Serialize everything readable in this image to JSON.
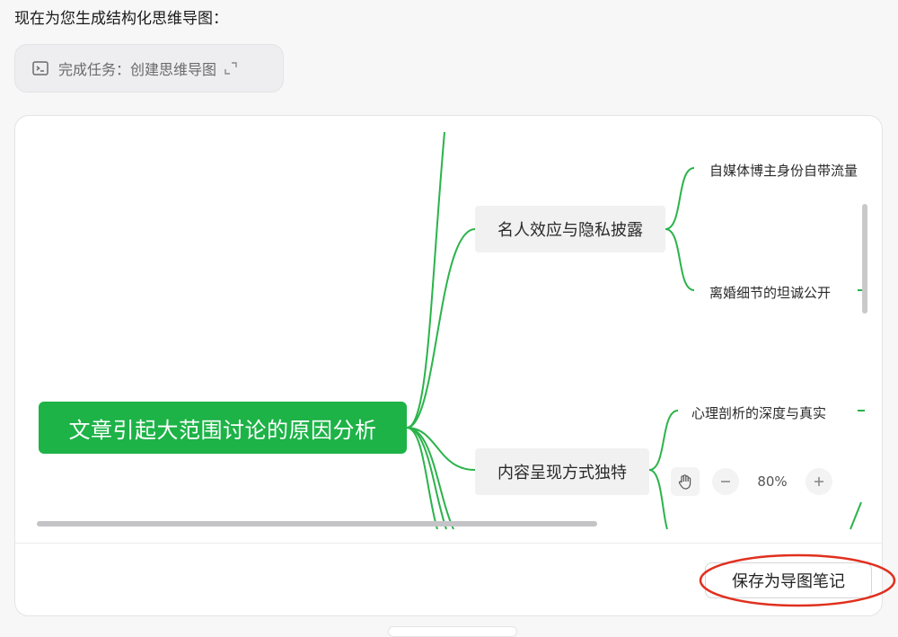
{
  "heading": "现在为您生成结构化思维导图：",
  "task_chip": {
    "label": "完成任务：创建思维导图",
    "icon": "terminal-icon",
    "expand_icon": "expand-icon"
  },
  "mindmap": {
    "root": "文章引起大范围讨论的原因分析",
    "branches": [
      {
        "label": "名人效应与隐私披露",
        "leaves": [
          "自媒体博主身份自带流量",
          "离婚细节的坦诚公开"
        ]
      },
      {
        "label": "内容呈现方式独特",
        "leaves": [
          "心理剖析的深度与真实"
        ]
      }
    ],
    "line_color": "#2bb34a"
  },
  "zoom": {
    "level": "80%",
    "hand_icon": "hand-icon",
    "minus_icon": "minus-icon",
    "plus_icon": "plus-icon"
  },
  "footer": {
    "save_label": "保存为导图笔记"
  },
  "colors": {
    "accent": "#1db347",
    "highlight": "#e0301e"
  }
}
